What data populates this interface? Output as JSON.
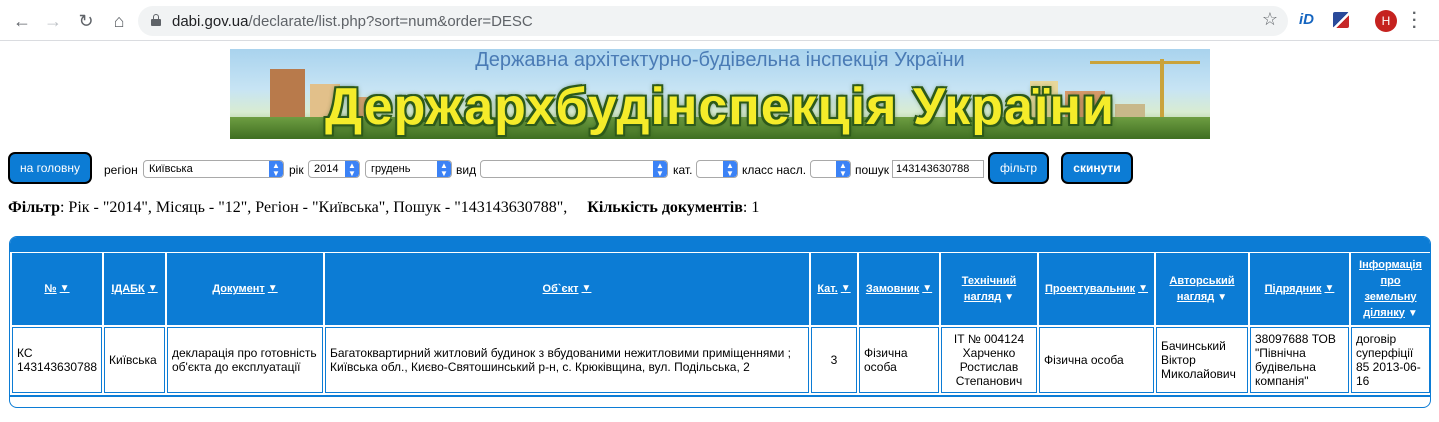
{
  "browser": {
    "url_host": "dabi.gov.ua",
    "url_path": "/declarate/list.php?sort=num&order=DESC",
    "profile_initial": "Н",
    "ext_label": "iD"
  },
  "banner": {
    "subtitle": "Державна архітектурно-будівельна інспекція України",
    "title": "Держархбудінспекція України"
  },
  "filters": {
    "home_button": "на головну",
    "region_label": "регіон",
    "region_value": "Київська",
    "year_label": "рік",
    "year_value": "2014",
    "month_value": "грудень",
    "type_label": "вид",
    "type_value": "",
    "cat_label": "кат.",
    "cat_value": "",
    "class_label": "класс насл.",
    "class_value": "",
    "search_label": "пошук",
    "search_value": "143143630788",
    "filter_button": "фільтр",
    "reset_button": "скинути"
  },
  "summary": {
    "filter_label": "Фільтр",
    "filter_text": ": Рік - \"2014\", Місяць - \"12\", Регіон - \"Київська\", Пошук - \"143143630788\",",
    "count_label": "Кількість документів",
    "count_text": ": 1"
  },
  "table": {
    "headers": {
      "num": "№",
      "idabk": "ІДАБК",
      "document": "Документ",
      "object": "Об`єкт",
      "cat": "Кат.",
      "customer": "Замовник",
      "tech_1": "Технічний",
      "tech_2": "нагляд",
      "designer": "Проектувальник",
      "author_1": "Авторський",
      "author_2": "нагляд",
      "contractor": "Підрядник",
      "land_1": "Інформація",
      "land_2": "про",
      "land_3": "земельну",
      "land_4": "ділянку"
    },
    "row": {
      "num_1": "КС",
      "num_2": "143143630788",
      "idabk": "Київська",
      "document_1": "декларація про готовність",
      "document_2": "об'єкта до експлуатації",
      "object_1": "Багатоквартирний житловий будинок з вбудованими нежитловими приміщеннями ;",
      "object_2": "Київська обл., Києво-Святошинський р-н, с. Крюківщина, вул. Подільська, 2",
      "cat": "3",
      "customer_1": "Фізична",
      "customer_2": "особа",
      "tech_1": "ІТ № 004124",
      "tech_2": "Харченко",
      "tech_3": "Ростислав",
      "tech_4": "Степанович",
      "designer": "Фізична особа",
      "author_1": "Бачинський",
      "author_2": "Віктор",
      "author_3": "Миколайович",
      "contractor_1": "38097688 ТОВ",
      "contractor_2": "\"Північна",
      "contractor_3": "будівельна",
      "contractor_4": "компанія\"",
      "land_1": "договір",
      "land_2": "суперфіції",
      "land_3": "85 2013-06-",
      "land_4": "16"
    }
  }
}
